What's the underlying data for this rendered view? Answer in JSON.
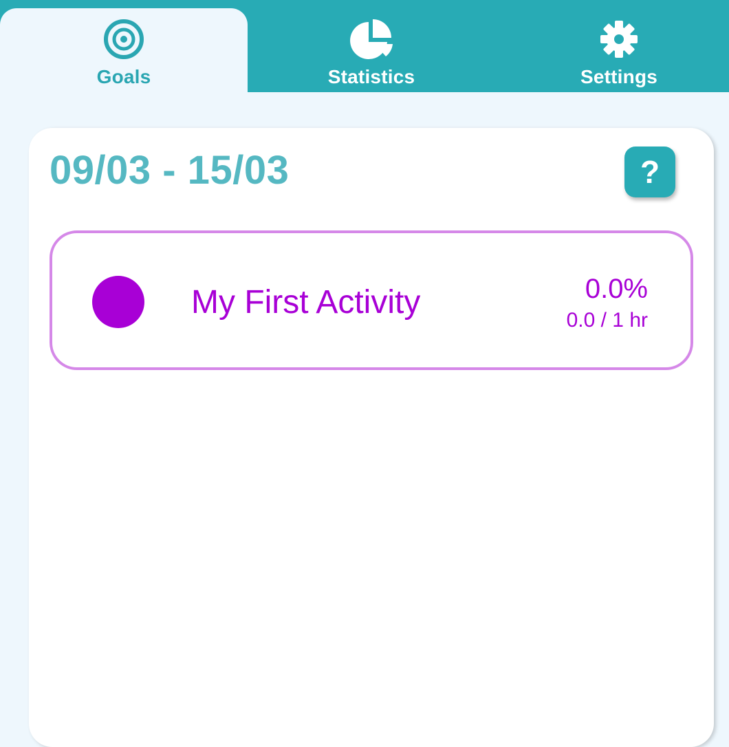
{
  "tabs": [
    {
      "label": "Goals",
      "icon": "target-icon",
      "active": true
    },
    {
      "label": "Statistics",
      "icon": "pie-chart-icon",
      "active": false
    },
    {
      "label": "Settings",
      "icon": "gear-icon",
      "active": false
    }
  ],
  "goals": {
    "date_range": "09/03 - 15/03",
    "help_label": "?",
    "activities": [
      {
        "name": "My First Activity",
        "percent": "0.0%",
        "progress": "0.0 / 1 hr",
        "color": "#a800d6"
      }
    ]
  },
  "colors": {
    "accent": "#28abb5",
    "date_text": "#55b8c2",
    "activity_border": "#d588e8",
    "background": "#eef7fd"
  }
}
